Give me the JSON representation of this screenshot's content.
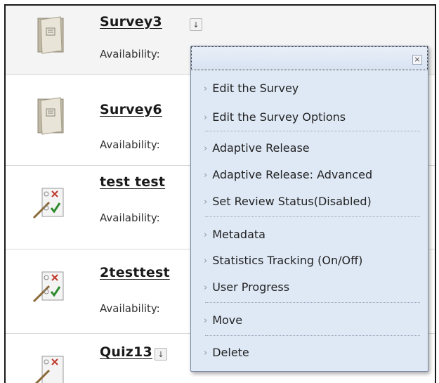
{
  "items": [
    {
      "title": "Survey3",
      "availability": "Availability:",
      "icon": "survey-clipboard-icon",
      "has_chevron": true
    },
    {
      "title": "Survey6",
      "availability": "Availability:",
      "icon": "survey-clipboard-icon"
    },
    {
      "title": "test test",
      "availability": "Availability:",
      "icon": "test-checklist-icon"
    },
    {
      "title": "2testtest",
      "availability": "Availability:",
      "icon": "test-checklist-icon"
    },
    {
      "title": "Quiz13",
      "availability": "",
      "icon": "test-checklist-icon"
    }
  ],
  "menu": {
    "close_label": "×",
    "items": [
      {
        "label": "Edit the Survey"
      },
      {
        "label": "Edit the Survey Options"
      },
      {
        "label": "Adaptive Release"
      },
      {
        "label": "Adaptive Release: Advanced"
      },
      {
        "label": "Set Review Status(Disabled)"
      },
      {
        "label": "Metadata"
      },
      {
        "label": "Statistics Tracking (On/Off)"
      },
      {
        "label": "User Progress"
      },
      {
        "label": "Move"
      },
      {
        "label": "Delete"
      }
    ]
  },
  "colors": {
    "menu_background": "#dfe9f6",
    "menu_border": "#7a8aa6",
    "row_highlight": "#f4f4f4"
  }
}
